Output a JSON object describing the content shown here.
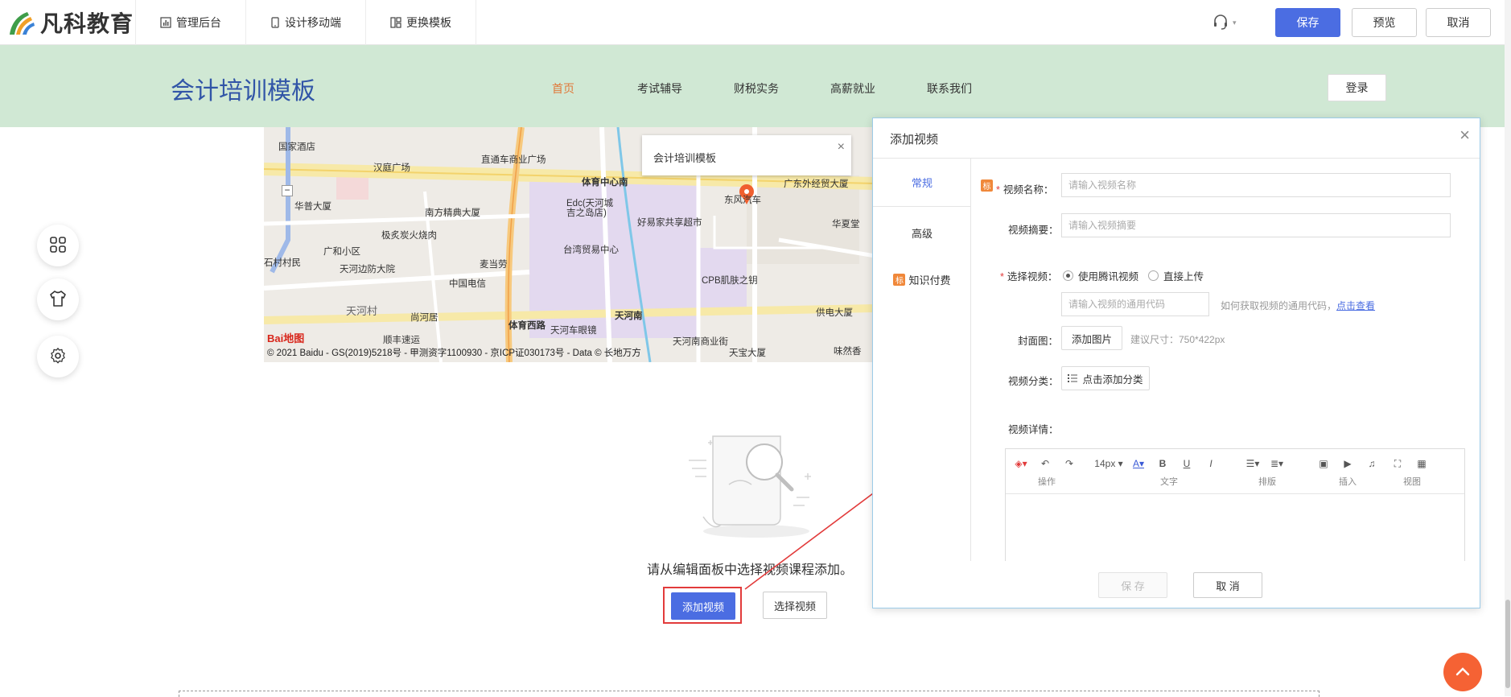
{
  "topbar": {
    "logo_text": "凡科教育",
    "nav": [
      {
        "label": "管理后台",
        "icon": "bar-chart-icon"
      },
      {
        "label": "设计移动端",
        "icon": "mobile-icon"
      },
      {
        "label": "更换模板",
        "icon": "template-icon"
      }
    ],
    "support_icon": "headset-icon",
    "save_label": "保存",
    "preview_label": "预览",
    "cancel_label": "取消",
    "primary_color": "#4b6de2"
  },
  "site": {
    "title": "会计培训模板",
    "nav": [
      {
        "label": "首页",
        "active": true
      },
      {
        "label": "考试辅导",
        "active": false
      },
      {
        "label": "财税实务",
        "active": false
      },
      {
        "label": "高薪就业",
        "active": false
      },
      {
        "label": "联系我们",
        "active": false
      }
    ],
    "login_label": "登录",
    "header_bg": "#d0e8d4"
  },
  "map": {
    "popup_title": "会计培训模板",
    "copyright": "© 2021 Baidu - GS(2019)5218号 - 甲测资字1100930 - 京ICP证030173号 - Data © 长地万方",
    "baidu_logo": "Bai地图",
    "labels": [
      "国家酒店",
      "汉庭广场",
      "直通车商业广场",
      "体育中心南",
      "广东外经贸大厦",
      "东风汽车",
      "华普大厦",
      "南方精典大厦",
      "Edc(天河城",
      "吉之岛店)",
      "好易家共享超市",
      "极炙炭火烧肉",
      "台湾贸易中心",
      "华夏堂",
      "广和小区",
      "天河边防大院",
      "麦当劳",
      "石村村民",
      "中国电信",
      "CPB肌肤之钥",
      "天河村",
      "尚河居",
      "体育西路",
      "天河南",
      "供电大厦",
      "顺丰速运",
      "天河车眼镜",
      "天河南商业街",
      "天宝大厦",
      "味然香"
    ]
  },
  "left_tools": [
    "apps-icon",
    "shirt-icon",
    "gear-icon"
  ],
  "empty_state": {
    "text": "请从编辑面板中选择视频课程添加。",
    "add_video_label": "添加视频",
    "select_video_label": "选择视频"
  },
  "dialog": {
    "title": "添加视频",
    "tabs": [
      {
        "label": "常规",
        "active": true
      },
      {
        "label": "高级",
        "active": false
      },
      {
        "label": "知识付费",
        "active": false,
        "badge": "标"
      }
    ],
    "fields": {
      "name_badge": "标",
      "name_label": "视频名称：",
      "name_placeholder": "请输入视频名称",
      "summary_label": "视频摘要：",
      "summary_placeholder": "请输入视频摘要",
      "select_label": "选择视频：",
      "radio_tencent": "使用腾讯视频",
      "radio_upload": "直接上传",
      "code_placeholder": "请输入视频的通用代码",
      "code_hint": "如何获取视频的通用代码，",
      "code_hint_link": "点击查看",
      "cover_label": "封面图：",
      "cover_btn": "添加图片",
      "cover_hint": "建议尺寸：750*422px",
      "category_label": "视频分类：",
      "category_btn": "点击添加分类",
      "detail_label": "视频详情："
    },
    "editor": {
      "font_size": "14px",
      "groups": [
        "操作",
        "文字",
        "排版",
        "插入",
        "视图"
      ]
    },
    "save_label": "保 存",
    "cancel_label": "取 消"
  },
  "scroll_top_color": "#f56234"
}
